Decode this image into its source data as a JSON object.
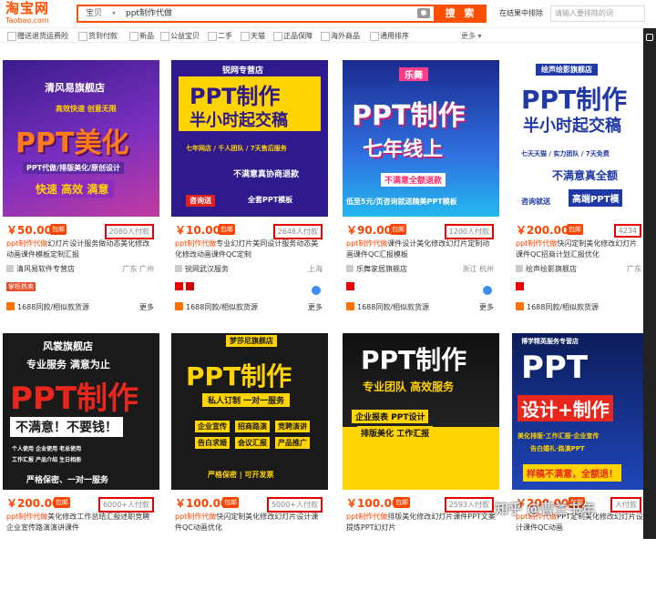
{
  "header": {
    "logo_cn": "淘宝网",
    "logo_en": "Taobao.com",
    "scope": "宝贝",
    "query": "ppt制作代做",
    "search_button": "搜 索",
    "exclude_label": "在结果中排除",
    "exclude_placeholder": "请输入要排除的词"
  },
  "filters": [
    "赠送退货运费险",
    "货到付款",
    "新品",
    "公益宝贝",
    "二手",
    "天猫",
    "正品保障",
    "海外商品",
    "通用排序"
  ],
  "filters_more": "更多",
  "cards": [
    {
      "poster": [
        "清风易旗舰店",
        "高效快速 创意无限",
        "PPT美化",
        "PPT代做/排版美化/原创设计",
        "快速 高效 满意"
      ],
      "price": "￥50.00",
      "badge": "包邮",
      "sales": "2080人付款",
      "title_hl": "ppt制作代做",
      "title": "幻灯片设计服务做动态美化修改动画课件模板定制汇报",
      "shop": "清风易软件专营店",
      "loc": "广东 广州",
      "tag": "掌柜热卖",
      "bottom": "1688同款/相似款货源",
      "more": "更多"
    },
    {
      "poster": [
        "锐网专营店",
        "PPT制作",
        "半小时起交稿",
        "七年网店 / 千人团队 / 7天售后服务",
        "不满意真协商退款",
        "咨询送",
        "全套PPT模板"
      ],
      "price": "￥10.00",
      "badge": "包邮",
      "sales": "2648人付款",
      "title_hl": "ppt制作代做",
      "title": "专业幻灯片美同设计服务动态美化修改动画课件QC定制",
      "shop": "锐网武汉服务",
      "loc": "上海",
      "bottom": "1688同款/相似款货源",
      "more": "更多"
    },
    {
      "poster": [
        "乐舞",
        "PPT制作",
        "七年线上",
        "不满意全额退款",
        "低至5元/页咨询就送精美PPT模板"
      ],
      "price": "￥90.00",
      "badge": "包邮",
      "sales": "1200人付款",
      "title_hl": "ppt制作代做",
      "title": "课件设计美化修改幻灯片定制动画课件QC汇报模板",
      "shop": "乐舞家居旗舰店",
      "loc": "浙江 杭州",
      "bottom": "1688同款/相似款货源",
      "more": "更多"
    },
    {
      "poster": [
        "绘声绘影旗舰店",
        "PPT制作",
        "半小时起交稿",
        "七天天猫 / 实力团队 / 7天免费",
        "不满意真全额",
        "咨询就送",
        "高端PPT模"
      ],
      "price": "￥200.00",
      "badge": "包邮",
      "sales": "4234",
      "title_hl": "ppt制作代做",
      "title": "快闪定制美化修改幻灯片课件QC招商计划汇报优化",
      "shop": "绘声绘影旗舰店",
      "loc": "广东",
      "bottom": "1688同款/相似款货源",
      "more": ""
    },
    {
      "poster": [
        "风裳旗舰店",
        "专业服务 满意为止",
        "PPT制作",
        "不满意！不要钱！",
        "个人使用 企业使用 老总使用",
        "工作汇报 产品介绍 生日相册",
        "严格保密、一对一服务"
      ],
      "price": "￥200.00",
      "badge": "包邮",
      "sales": "6000+人付款",
      "title_hl": "ppt制作代做",
      "title": "美化修改工作总结汇报述职竞聘企业宣传路演演讲课件",
      "shop": "",
      "loc": "",
      "bottom": "",
      "more": ""
    },
    {
      "poster": [
        "梦莎尼旗舰店",
        "PPT制作",
        "私人订制 一对一服务",
        "企业宣传",
        "招商路演",
        "竞聘演讲",
        "告白求婚",
        "会议汇报",
        "产品推广",
        "严格保密 | 可开发票"
      ],
      "price": "￥100.00",
      "badge": "包邮",
      "sales": "5000+人付款",
      "title_hl": "ppt制作代做",
      "title": "快闪定制美化修改幻灯片设计课件QC动画优化",
      "shop": "",
      "loc": "",
      "bottom": "",
      "more": ""
    },
    {
      "poster": [
        "PPT制作",
        "专业团队 高效服务",
        "企业报表 PPT设计",
        "排版美化 工作汇报"
      ],
      "price": "￥100.00",
      "badge": "包邮",
      "sales": "2593人付款",
      "title_hl": "ppt制作代做",
      "title": "排版美化修改幻灯片课件PPT文案提炼PPT幻灯片",
      "shop": "",
      "loc": "",
      "bottom": "",
      "more": ""
    },
    {
      "poster": [
        "博学精英服务专营店",
        "PPT",
        "设计+制作",
        "美化排版·工作汇报·企业宣传",
        "告白婚礼·路演PPT",
        "样稿不满意，全额退！"
      ],
      "price": "￥200.00",
      "badge": "包邮",
      "sales": "人付款",
      "title_hl": "ppt制作代做",
      "title": "PPT定制美化修改幻灯片设计课件QC动画",
      "shop": "",
      "loc": "",
      "bottom": "",
      "more": ""
    }
  ],
  "watermark": "知乎 @曹兰书年",
  "colors": {
    "accent": "#ff5000",
    "price": "#ff4400",
    "highlight_box": "#e60000"
  }
}
